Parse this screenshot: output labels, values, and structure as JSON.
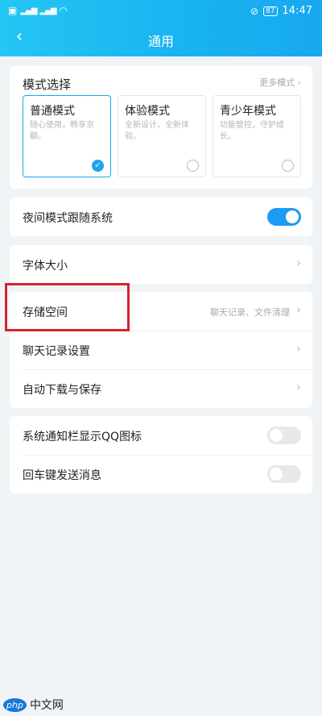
{
  "status_bar": {
    "left_indicators": [
      "4G",
      "4G"
    ],
    "battery": "87",
    "time": "14:47"
  },
  "nav": {
    "back_glyph": "‹",
    "title": "通用"
  },
  "mode_section": {
    "title": "模式选择",
    "more_label": "更多模式",
    "modes": [
      {
        "name": "普通模式",
        "desc": "随心使用，畅享京聊。",
        "selected": true
      },
      {
        "name": "体验模式",
        "desc": "全新设计，全新体验。",
        "selected": false
      },
      {
        "name": "青少年模式",
        "desc": "功能管控，守护成长。",
        "selected": false
      }
    ]
  },
  "night_mode": {
    "label": "夜间模式跟随系统",
    "enabled": true
  },
  "font_size": {
    "label": "字体大小"
  },
  "storage_group": {
    "items": [
      {
        "label": "存储空间",
        "hint": "聊天记录、文件清理"
      },
      {
        "label": "聊天记录设置",
        "hint": ""
      },
      {
        "label": "自动下载与保存",
        "hint": ""
      }
    ]
  },
  "notify_group": {
    "items": [
      {
        "label": "系统通知栏显示QQ图标",
        "enabled": false
      },
      {
        "label": "回车键发送消息",
        "enabled": false
      }
    ]
  },
  "watermark": {
    "logo": "php",
    "text": "中文网"
  },
  "colors": {
    "accent": "#1aa7ed",
    "highlight": "#d3242c",
    "background": "#f1f4f7"
  }
}
